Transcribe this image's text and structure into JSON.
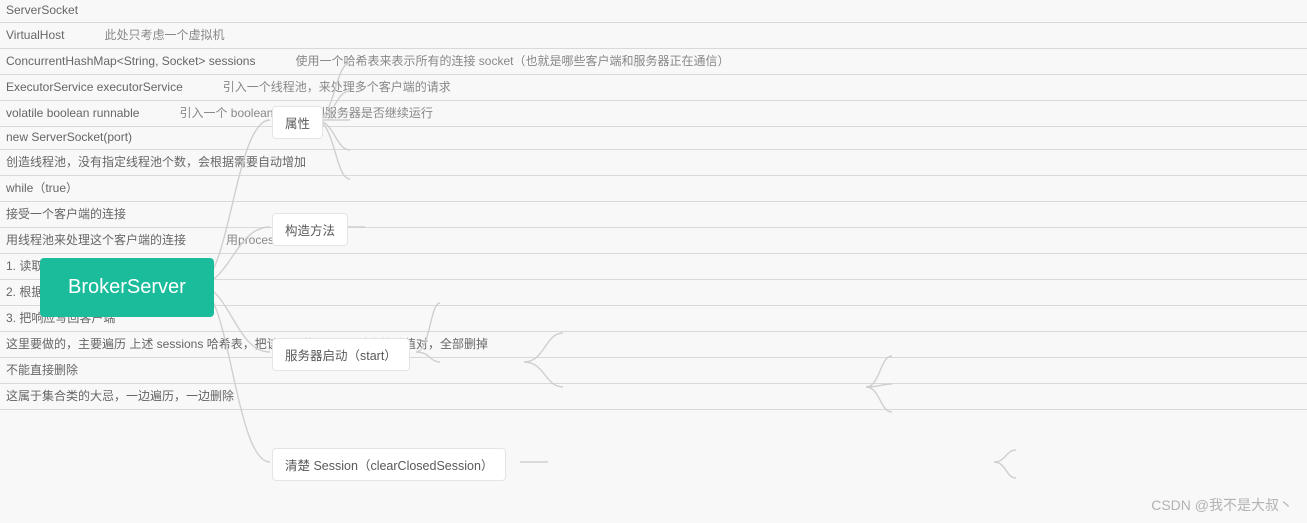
{
  "root": {
    "label": "BrokerServer"
  },
  "attributes": {
    "label": "属性",
    "items": [
      {
        "text": "ServerSocket"
      },
      {
        "text": "VirtualHost",
        "note": "此处只考虑一个虚拟机"
      },
      {
        "text": "ConcurrentHashMap<String, Socket> sessions",
        "note": "使用一个哈希表来表示所有的连接 socket（也就是哪些客户端和服务器正在通信）"
      },
      {
        "text": "ExecutorService executorService",
        "note": "引入一个线程池，来处理多个客户端的请求"
      },
      {
        "text": "volatile boolean runnable",
        "note": "引入一个 boolean 变量控制服务器是否继续运行"
      }
    ]
  },
  "constructor": {
    "label": "构造方法",
    "child": "new ServerSocket(port)"
  },
  "start": {
    "label": "服务器启动（start）",
    "pool": "创造线程池，没有指定线程池个数，会根据需要自动增加",
    "loop": {
      "label": "while（true）",
      "accept": "接受一个客户端的连接",
      "process": {
        "text": "用线程池来处理这个客户端的连接",
        "note": "用processConnection"
      },
      "steps": [
        "1. 读取请求并解析",
        "2. 根据请求计算响应",
        "3. 把响应写回客户端"
      ]
    }
  },
  "clear": {
    "label": "清楚 Session（clearClosedSession）",
    "desc": "这里要做的，主要遍历 上述 sessions 哈希表，把该关闭的 socket 对应的键值对，全部删掉",
    "notes": [
      "不能直接删除",
      "这属于集合类的大忌，一边遍历，一边删除"
    ]
  },
  "watermark": "CSDN @我不是大叔丶"
}
